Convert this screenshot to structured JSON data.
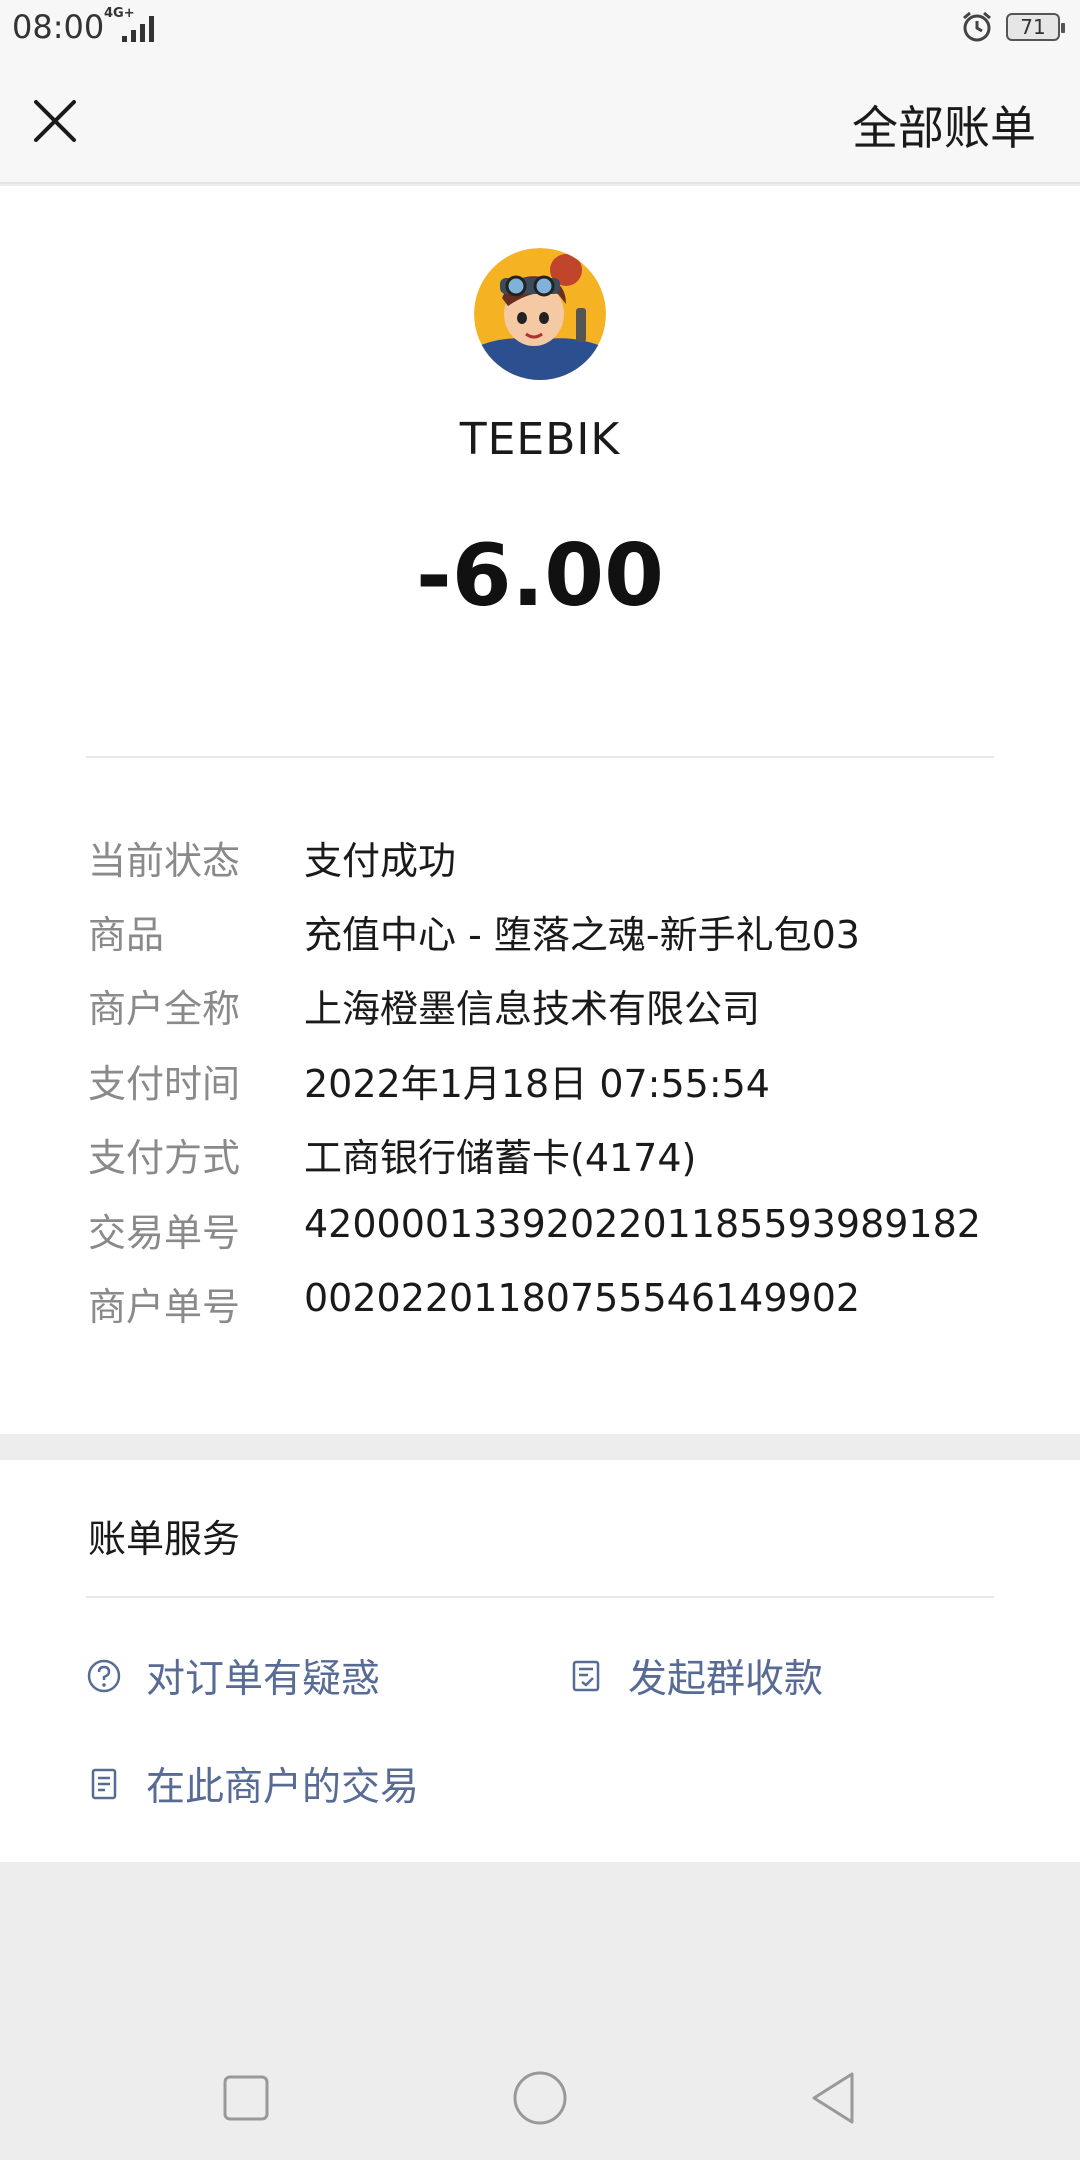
{
  "status_bar": {
    "time": "08:00",
    "network": "4G+",
    "battery": "71"
  },
  "header": {
    "all_bills_label": "全部账单"
  },
  "merchant": {
    "name": "TEEBIK",
    "amount": "-6.00"
  },
  "details": [
    {
      "label": "当前状态",
      "value": "支付成功"
    },
    {
      "label": "商品",
      "value": "充值中心 - 堕落之魂-新手礼包03"
    },
    {
      "label": "商户全称",
      "value": "上海橙墨信息技术有限公司"
    },
    {
      "label": "支付时间",
      "value": "2022年1月18日 07:55:54"
    },
    {
      "label": "支付方式",
      "value": "工商银行储蓄卡(4174)"
    },
    {
      "label": "交易单号",
      "value": "4200001339202201185593989182"
    },
    {
      "label": "商户单号",
      "value": "00202201180755546149902"
    }
  ],
  "services": {
    "title": "账单服务",
    "order_question": "对订单有疑惑",
    "group_collect": "发起群收款",
    "merchant_transactions": "在此商户的交易"
  },
  "colors": {
    "link": "#576b95",
    "label_gray": "#8a8a8a",
    "background": "#ededed"
  }
}
